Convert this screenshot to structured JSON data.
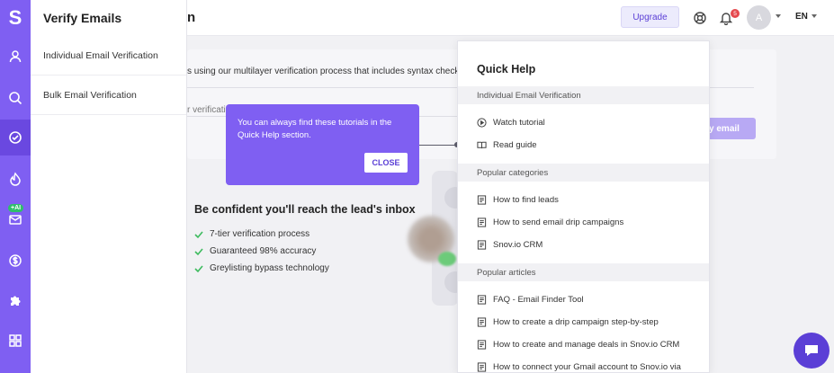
{
  "app": {
    "logo_letter": "S",
    "brand_color": "#7f5ff2",
    "rail_icons": [
      "user-icon",
      "search-icon",
      "check-circle-icon",
      "drip-icon",
      "mail-icon",
      "dollar-icon",
      "puzzle-icon",
      "grid-icon"
    ],
    "ai_badge": "+AI"
  },
  "flyout": {
    "title": "Verify Emails",
    "items": [
      {
        "label": "Individual Email Verification"
      },
      {
        "label": "Bulk Email Verification"
      }
    ]
  },
  "header": {
    "title_tail": "n",
    "upgrade_label": "Upgrade",
    "notification_count": "5",
    "avatar_letter": "A",
    "language": "EN"
  },
  "main": {
    "description": "s using our multilayer verification process that includes syntax check, M",
    "input_hint": "r verification",
    "verify_button": "rify email",
    "confident_heading": "Be confident you'll reach the lead's inbox",
    "features": [
      "7-tier verification process",
      "Guaranteed 98% accuracy",
      "Greylisting bypass technology"
    ]
  },
  "tooltip": {
    "text": "You can always find these tutorials in the Quick Help section.",
    "close_label": "CLOSE"
  },
  "quick_help": {
    "title": "Quick Help",
    "sections": [
      {
        "header": "Individual Email Verification",
        "items": [
          {
            "icon": "play-icon",
            "label": "Watch tutorial"
          },
          {
            "icon": "book-icon",
            "label": "Read guide"
          }
        ]
      },
      {
        "header": "Popular categories",
        "items": [
          {
            "icon": "doc-icon",
            "label": "How to find leads"
          },
          {
            "icon": "doc-icon",
            "label": "How to send email drip campaigns"
          },
          {
            "icon": "doc-icon",
            "label": "Snov.io CRM"
          }
        ]
      },
      {
        "header": "Popular articles",
        "items": [
          {
            "icon": "doc-icon",
            "label": "FAQ - Email Finder Tool"
          },
          {
            "icon": "doc-icon",
            "label": "How to create a drip campaign step-by-step"
          },
          {
            "icon": "doc-icon",
            "label": "How to create and manage deals in Snov.io CRM"
          },
          {
            "icon": "doc-icon",
            "label": "How to connect your Gmail account to Snov.io via"
          }
        ]
      }
    ]
  }
}
